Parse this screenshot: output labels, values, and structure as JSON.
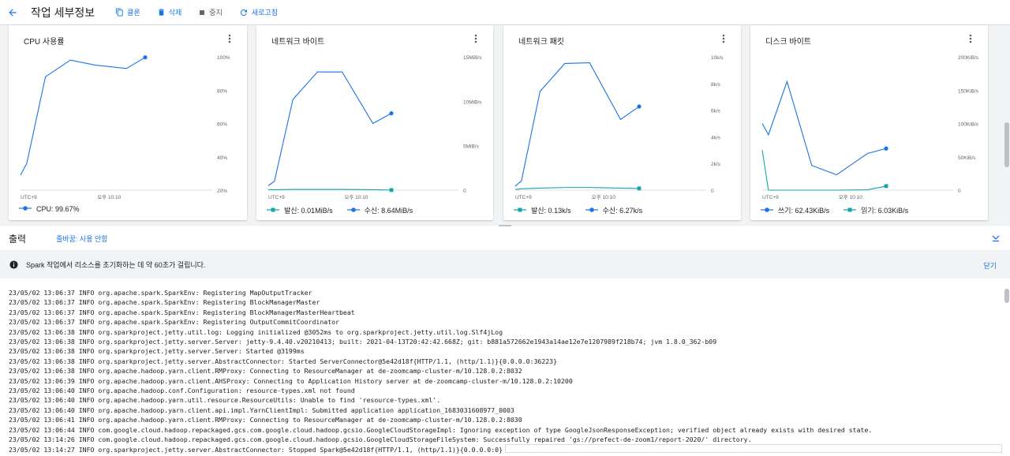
{
  "header": {
    "title": "작업 세부정보",
    "buttons": [
      {
        "label": "클론",
        "icon": "copy-icon"
      },
      {
        "label": "삭제",
        "icon": "trash-icon"
      },
      {
        "label": "중지",
        "icon": "stop-icon"
      },
      {
        "label": "새로고침",
        "icon": "refresh-icon"
      }
    ]
  },
  "colors": {
    "accent": "#1a73e8",
    "series_blue": "#1a73e8",
    "series_teal": "#12a4af"
  },
  "chart_data": [
    {
      "type": "line",
      "title": "CPU 사용률",
      "x_labels": [
        "UTC+9",
        "오후 10:10"
      ],
      "y_ticks": [
        "100%",
        "80%",
        "60%",
        "40%",
        "20%"
      ],
      "ylim": [
        20,
        100
      ],
      "series": [
        {
          "name": "CPU",
          "legend_value": "99.67%",
          "color": "#1a73e8",
          "marker": "circle",
          "values": [
            29,
            36,
            88,
            98,
            95,
            93,
            99.67
          ]
        }
      ]
    },
    {
      "type": "line",
      "title": "네트워크 바이트",
      "x_labels": [
        "UTC+9",
        "오후 10:10"
      ],
      "y_ticks": [
        "15MiB/s",
        "10MiB/s",
        "5MiB/s",
        "0"
      ],
      "ylim": [
        0,
        15
      ],
      "series": [
        {
          "name": "발신",
          "legend_value": "0.01MiB/s",
          "color": "#12a4af",
          "marker": "square",
          "values": [
            0.05,
            0.05,
            0.08,
            0.08,
            0.08,
            0.05,
            0.01
          ]
        },
        {
          "name": "수신",
          "legend_value": "8.64MiB/s",
          "color": "#1a73e8",
          "marker": "circle",
          "values": [
            0.5,
            1.0,
            10.2,
            13.3,
            13.3,
            7.5,
            8.64
          ]
        }
      ]
    },
    {
      "type": "line",
      "title": "네트워크 패킷",
      "x_labels": [
        "UTC+9",
        "오후 10:10"
      ],
      "y_ticks": [
        "10k/s",
        "8k/s",
        "6k/s",
        "4k/s",
        "2k/s",
        "0"
      ],
      "ylim": [
        0,
        10
      ],
      "series": [
        {
          "name": "발신",
          "legend_value": "0.13k/s",
          "color": "#12a4af",
          "marker": "square",
          "values": [
            0.05,
            0.1,
            0.15,
            0.2,
            0.2,
            0.15,
            0.13
          ]
        },
        {
          "name": "수신",
          "legend_value": "6.27k/s",
          "color": "#1a73e8",
          "marker": "circle",
          "values": [
            0.3,
            0.7,
            7.4,
            9.5,
            9.55,
            5.3,
            6.27
          ]
        }
      ]
    },
    {
      "type": "line",
      "title": "디스크 바이트",
      "x_labels": [
        "UTC+9",
        "오후 10:10"
      ],
      "y_ticks": [
        "200KiB/s",
        "150KiB/s",
        "100KiB/s",
        "50KiB/s",
        "0"
      ],
      "ylim": [
        0,
        200
      ],
      "series": [
        {
          "name": "쓰기",
          "legend_value": "62.43KiB/s",
          "color": "#1a73e8",
          "marker": "circle",
          "values": [
            100,
            83,
            163,
            37,
            23,
            55,
            62.43
          ]
        },
        {
          "name": "읽기",
          "legend_value": "6.03KiB/s",
          "color": "#12a4af",
          "marker": "square",
          "values": [
            60,
            0,
            0,
            0,
            0,
            0.5,
            6.03
          ]
        }
      ]
    }
  ],
  "output": {
    "title": "출력",
    "wrap_label": "줄바꿈: 사용 안함",
    "banner_text": "Spark 작업에서 리소스를 초기화하는 데 약 60초가 걸립니다.",
    "banner_close": "닫기",
    "log_lines": [
      "23/05/02 13:06:37 INFO org.apache.spark.SparkEnv: Registering MapOutputTracker",
      "23/05/02 13:06:37 INFO org.apache.spark.SparkEnv: Registering BlockManagerMaster",
      "23/05/02 13:06:37 INFO org.apache.spark.SparkEnv: Registering BlockManagerMasterHeartbeat",
      "23/05/02 13:06:37 INFO org.apache.spark.SparkEnv: Registering OutputCommitCoordinator",
      "23/05/02 13:06:38 INFO org.sparkproject.jetty.util.log: Logging initialized @3052ms to org.sparkproject.jetty.util.log.Slf4jLog",
      "23/05/02 13:06:38 INFO org.sparkproject.jetty.server.Server: jetty-9.4.40.v20210413; built: 2021-04-13T20:42:42.668Z; git: b881a572662e1943a14ae12e7e1207989f218b74; jvm 1.8.0_362-b09",
      "23/05/02 13:06:38 INFO org.sparkproject.jetty.server.Server: Started @3199ms",
      "23/05/02 13:06:38 INFO org.sparkproject.jetty.server.AbstractConnector: Started ServerConnector@5e42d18f{HTTP/1.1, (http/1.1)}{0.0.0.0:36223}",
      "23/05/02 13:06:38 INFO org.apache.hadoop.yarn.client.RMProxy: Connecting to ResourceManager at de-zoomcamp-cluster-m/10.128.0.2:8032",
      "23/05/02 13:06:39 INFO org.apache.hadoop.yarn.client.AHSProxy: Connecting to Application History server at de-zoomcamp-cluster-m/10.128.0.2:10200",
      "23/05/02 13:06:40 INFO org.apache.hadoop.conf.Configuration: resource-types.xml not found",
      "23/05/02 13:06:40 INFO org.apache.hadoop.yarn.util.resource.ResourceUtils: Unable to find 'resource-types.xml'.",
      "23/05/02 13:06:40 INFO org.apache.hadoop.yarn.client.api.impl.YarnClientImpl: Submitted application application_1683031608977_0003",
      "23/05/02 13:06:41 INFO org.apache.hadoop.yarn.client.RMProxy: Connecting to ResourceManager at de-zoomcamp-cluster-m/10.128.0.2:8030",
      "23/05/02 13:06:44 INFO com.google.cloud.hadoop.repackaged.gcs.com.google.cloud.hadoop.gcsio.GoogleCloudStorageImpl: Ignoring exception of type GoogleJsonResponseException; verified object already exists with desired state.",
      "23/05/02 13:14:26 INFO com.google.cloud.hadoop.repackaged.gcs.com.google.cloud.hadoop.gcsio.GoogleCloudStorageFileSystem: Successfully repaired 'gs://prefect-de-zoom1/report-2020/' directory.",
      "23/05/02 13:14:27 INFO org.sparkproject.jetty.server.AbstractConnector: Stopped Spark@5e42d18f{HTTP/1.1, (http/1.1)}{0.0.0.0:0}"
    ]
  }
}
